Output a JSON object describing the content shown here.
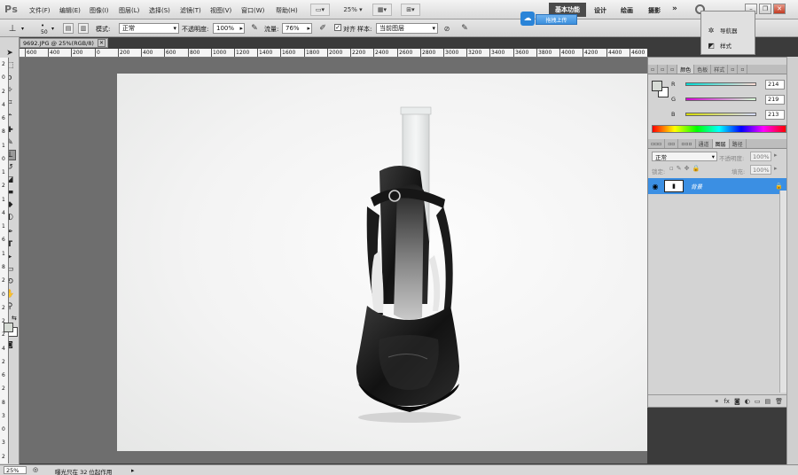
{
  "app": {
    "logo": "Ps"
  },
  "menu": [
    "文件(F)",
    "编辑(E)",
    "图像(I)",
    "图层(L)",
    "选择(S)",
    "滤镜(T)",
    "视图(V)",
    "窗口(W)",
    "帮助(H)"
  ],
  "menubar_controls": {
    "zoom": "25%"
  },
  "workspaces": {
    "active": "基本功能",
    "design": "设计",
    "painting": "绘画",
    "photography": "摄影",
    "more": "»"
  },
  "options": {
    "brush_size": "50",
    "mode_label": "模式:",
    "mode_value": "正常",
    "opacity_label": "不透明度:",
    "opacity_value": "100%",
    "flow_label": "流量:",
    "flow_value": "76%",
    "align_label": "对齐",
    "sample_label": "样本:",
    "sample_value": "当前图层"
  },
  "upload_popup": {
    "label": "拖拽上传"
  },
  "document": {
    "tab_title": "9692.JPG @ 25%(RGB/8)"
  },
  "ruler_top": [
    "600",
    "400",
    "200",
    "0",
    "200",
    "400",
    "600",
    "800",
    "1000",
    "1200",
    "1400",
    "1600",
    "1800",
    "2000",
    "2200",
    "2400",
    "2600",
    "2800",
    "3000",
    "3200",
    "3400",
    "3600",
    "3800",
    "4000",
    "4200",
    "4400",
    "4600"
  ],
  "ruler_left": [
    "2",
    "0",
    "2",
    "4",
    "6",
    "8",
    "1",
    "0",
    "1",
    "2",
    "1",
    "4",
    "1",
    "6",
    "1",
    "8",
    "2",
    "0",
    "2",
    "2",
    "2",
    "4",
    "2",
    "6",
    "2",
    "8",
    "3",
    "0",
    "3",
    "2"
  ],
  "status": {
    "zoom": "25%",
    "message": "曝光只在 32 位起作用"
  },
  "mini_panel": {
    "navigator": "导航器",
    "styles": "样式"
  },
  "color_panel": {
    "tabs": [
      "颜色",
      "色板",
      "样式"
    ],
    "r_label": "R",
    "r_value": "214",
    "g_label": "G",
    "g_value": "219",
    "b_label": "B",
    "b_value": "213"
  },
  "layers_panel": {
    "tabs": [
      "图层",
      "通道",
      "路径"
    ],
    "blend_mode": "正常",
    "opacity_label": "不透明度:",
    "opacity_value": "100%",
    "lock_label": "锁定:",
    "fill_label": "填充:",
    "fill_value": "100%",
    "layer_name": "背景"
  },
  "colors": {
    "selected_layer": "#3b8fe3",
    "workspace_active": "#4b4b4b"
  }
}
